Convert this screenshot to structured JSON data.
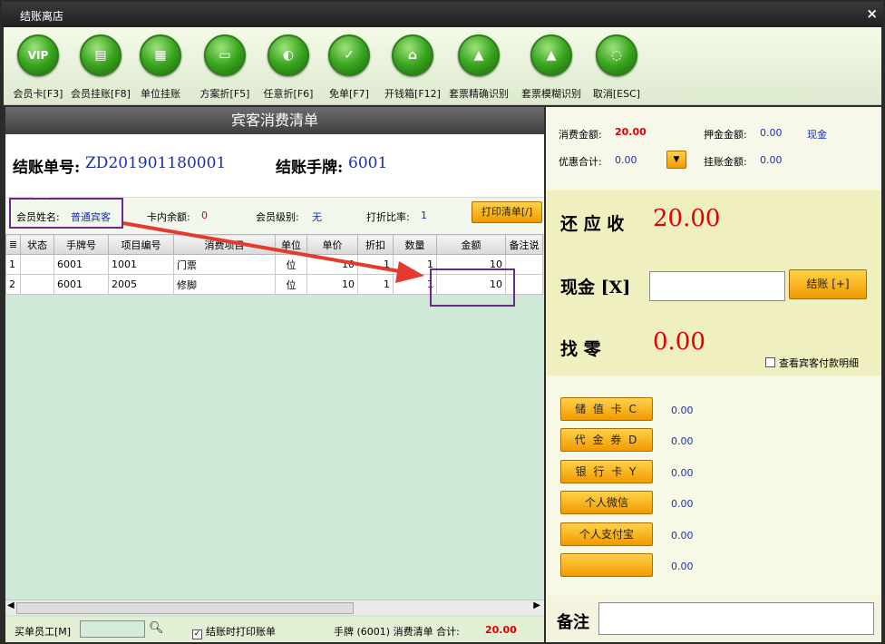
{
  "window": {
    "title": "结账离店",
    "close": "×"
  },
  "toolbar": [
    {
      "label": "会员卡[F3]",
      "icon": "vip-icon",
      "glyph": "VIP"
    },
    {
      "label": "会员挂账[F8]",
      "icon": "member-credit-icon",
      "glyph": "▤"
    },
    {
      "label": "单位挂账",
      "icon": "company-credit-icon",
      "glyph": "▦"
    },
    {
      "label": "方案折[F5]",
      "icon": "plan-discount-icon",
      "glyph": "▭"
    },
    {
      "label": "任意折[F6]",
      "icon": "custom-discount-icon",
      "glyph": "◐"
    },
    {
      "label": "免单[F7]",
      "icon": "free-order-icon",
      "glyph": "✓"
    },
    {
      "label": "开钱箱[F12]",
      "icon": "cash-box-icon",
      "glyph": "⌂"
    },
    {
      "label": "套票精确识别",
      "icon": "package-exact-icon",
      "glyph": "▲"
    },
    {
      "label": "套票模糊识别",
      "icon": "package-fuzzy-icon",
      "glyph": "▲"
    },
    {
      "label": "取消[ESC]",
      "icon": "cancel-icon",
      "glyph": "◌"
    }
  ],
  "bill": {
    "header": "宾客消费清单",
    "no_label": "结账单号:",
    "no_value": "ZD201901180001",
    "tag_label": "结账手牌:",
    "tag_value": "6001"
  },
  "member": {
    "name_label": "会员姓名:",
    "name_value": "普通宾客",
    "balance_label": "卡内余额:",
    "balance_value": "0",
    "level_label": "会员级别:",
    "level_value": "无",
    "discount_label": "打折比率:",
    "discount_value": "1",
    "print_button": "打印清单[/]"
  },
  "grid": {
    "columns": [
      "≣",
      "状态",
      "手牌号",
      "项目编号",
      "消费项目",
      "单位",
      "单价",
      "折扣",
      "数量",
      "金额",
      "备注说"
    ],
    "rows": [
      [
        "1",
        "",
        "6001",
        "1001",
        "门票",
        "位",
        "10",
        "1",
        "1",
        "10",
        ""
      ],
      [
        "2",
        "",
        "6001",
        "2005",
        "修脚",
        "位",
        "10",
        "1",
        "1",
        "10",
        ""
      ]
    ]
  },
  "footer": {
    "clerk_label": "买单员工[M]",
    "print_check": "结账时打印账单",
    "summary_label": "手牌 (6001) 消费清单 合计:",
    "summary_total": "20.00"
  },
  "summary": {
    "consume_label": "消费金额:",
    "consume_value": "20.00",
    "deposit_label": "押金金额:",
    "deposit_value": "0.00",
    "deposit_type": "现金",
    "discount_label": "优惠合计:",
    "discount_value": "0.00",
    "credit_label": "挂账金额:",
    "credit_value": "0.00"
  },
  "payment": {
    "due_label": "还 应 收",
    "due_value": "20.00",
    "cash_label": "现金 [X]",
    "settle_button": "结账 [+]",
    "change_label": "找    零",
    "change_value": "0.00",
    "detail_check": "查看宾客付款明细",
    "methods": [
      {
        "label": "储 值 卡 C",
        "value": "0.00"
      },
      {
        "label": "代 金 券 D",
        "value": "0.00"
      },
      {
        "label": "银 行 卡 Y",
        "value": "0.00"
      },
      {
        "label": "个人微信",
        "value": "0.00"
      },
      {
        "label": "个人支付宝",
        "value": "0.00"
      },
      {
        "label": "",
        "value": "0.00"
      }
    ],
    "remark_label": "备注"
  },
  "colors": {
    "accent": "#f09a00",
    "value_blue": "#1d2fb1",
    "amount_red": "#e00000",
    "highlight": "#6a2a8a",
    "arrow": "#e53a2f"
  }
}
